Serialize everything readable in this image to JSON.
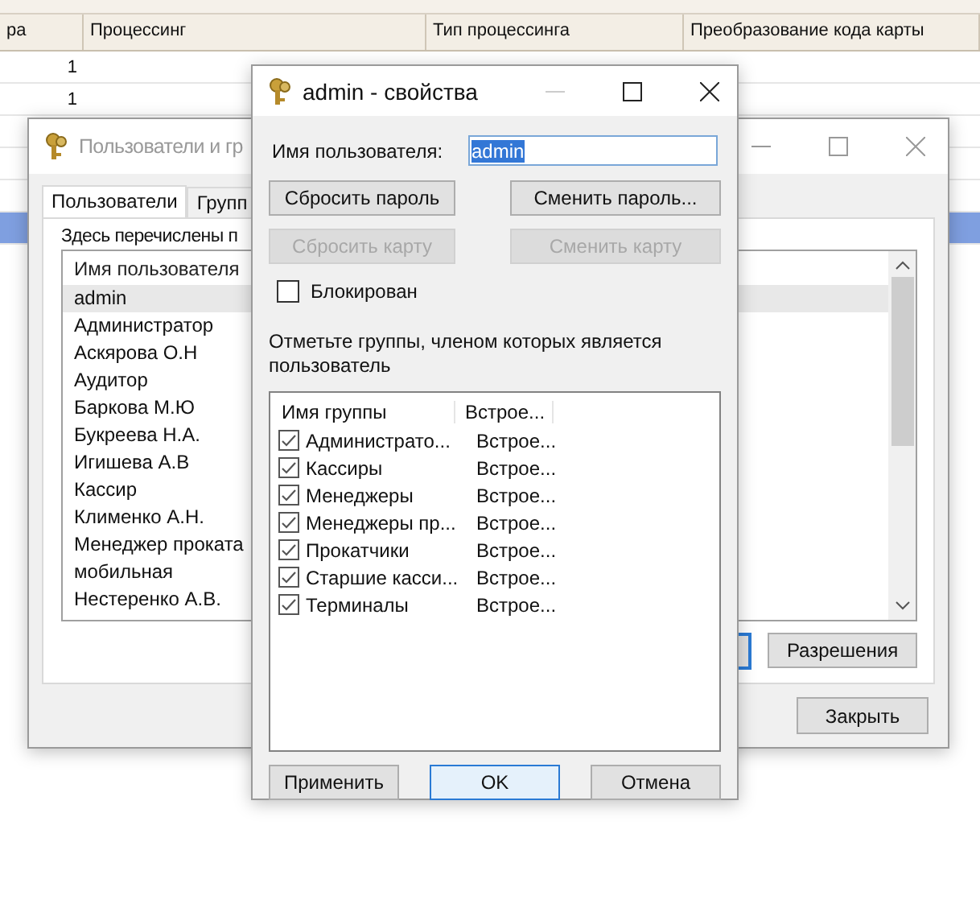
{
  "background_table": {
    "columns": [
      "ра",
      "Процессинг",
      "Тип процессинга",
      "Преобразование кода карты"
    ],
    "rows": [
      {
        "column_1": "1",
        "selected": false
      },
      {
        "column_1": "1",
        "selected": false
      },
      {
        "selected": false
      },
      {
        "selected": false
      },
      {
        "selected": false
      },
      {
        "selected": true
      }
    ]
  },
  "users_window": {
    "title": "Пользователи и гр",
    "tabs": [
      {
        "label": "Пользователи",
        "selected": true
      },
      {
        "label": "Групп",
        "selected": false
      }
    ],
    "description": "Здесь перечислены п",
    "users": {
      "column": "Имя пользователя",
      "items": [
        {
          "name": "admin",
          "selected": true
        },
        {
          "name": "Администратор",
          "selected": false
        },
        {
          "name": "Аскярова О.Н",
          "selected": false
        },
        {
          "name": "Аудитор",
          "selected": false
        },
        {
          "name": "Баркова М.Ю",
          "selected": false
        },
        {
          "name": "Букреева Н.А.",
          "selected": false
        },
        {
          "name": "Игишева А.В",
          "selected": false
        },
        {
          "name": "Кассир",
          "selected": false
        },
        {
          "name": "Клименко А.Н.",
          "selected": false
        },
        {
          "name": "Менеджер проката",
          "selected": false
        },
        {
          "name": "мобильная",
          "selected": false
        },
        {
          "name": "Нестеренко А.В.",
          "selected": false
        }
      ]
    },
    "permissions_button": "Разрешения",
    "close_button": "Закрыть"
  },
  "properties_dialog": {
    "title": "admin - свойства",
    "username_label": "Имя пользователя:",
    "username_value": "admin",
    "buttons": [
      {
        "label": "Сбросить пароль",
        "disabled": false
      },
      {
        "label": "Сменить пароль...",
        "disabled": false
      },
      {
        "label": "Сбросить карту",
        "disabled": true
      },
      {
        "label": "Сменить карту",
        "disabled": true
      }
    ],
    "blocked": {
      "label": "Блокирован",
      "checked": false
    },
    "groups_hint": "Отметьте группы, членом которых является пользователь",
    "groups": {
      "columns": [
        "Имя группы",
        "Встрое..."
      ],
      "items": [
        {
          "name": "Администрато...",
          "type": "Встрое...",
          "checked": true
        },
        {
          "name": "Кассиры",
          "type": "Встрое...",
          "checked": true
        },
        {
          "name": "Менеджеры",
          "type": "Встрое...",
          "checked": true
        },
        {
          "name": "Менеджеры пр...",
          "type": "Встрое...",
          "checked": true
        },
        {
          "name": "Прокатчики",
          "type": "Встрое...",
          "checked": true
        },
        {
          "name": "Старшие касси...",
          "type": "Встрое...",
          "checked": true
        },
        {
          "name": "Терминалы",
          "type": "Встрое...",
          "checked": true
        }
      ]
    },
    "footer_buttons": [
      {
        "label": "Применить",
        "default": false
      },
      {
        "label": "OK",
        "default": true
      },
      {
        "label": "Отмена",
        "default": false
      }
    ]
  }
}
